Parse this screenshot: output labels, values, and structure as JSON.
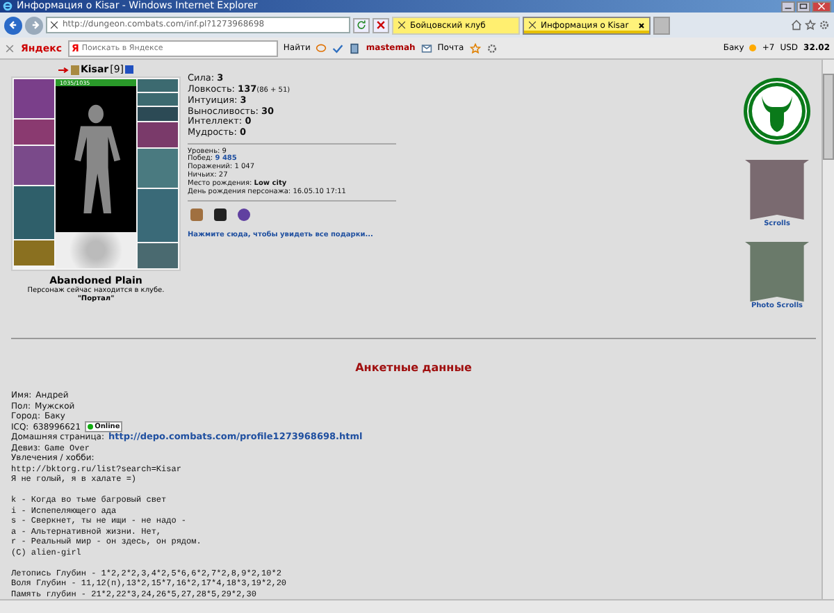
{
  "window": {
    "title": "Информация о Kisar - Windows Internet Explorer"
  },
  "browser": {
    "address": "http://dungeon.combats.com/inf.pl?1273968698",
    "tabs": [
      {
        "label": "Бойцовский клуб",
        "selected": false
      },
      {
        "label": "Информация о Kisar",
        "selected": true
      }
    ]
  },
  "toolbar": {
    "brand": "Яндекс",
    "search_logo": "Я",
    "search_placeholder": "Поискать в Яндексе",
    "find": "Найти",
    "user": "mastemah",
    "mail": "Почта",
    "city": "Баку",
    "temperature": "+7",
    "currency": "USD",
    "rate": "32.02"
  },
  "character": {
    "name": "Kisar",
    "level": "[9]",
    "hp": {
      "text": "1035/1035",
      "level": 1
    },
    "location": "Abandoned Plain",
    "note": "Персонаж сейчас находится в клубе.",
    "club": "\"Портал\""
  },
  "stats": [
    {
      "label": "Сила:",
      "value": "3"
    },
    {
      "label": "Ловкость:",
      "value": "137",
      "extra": "(86 + 51)"
    },
    {
      "label": "Интуиция:",
      "value": "3"
    },
    {
      "label": "Выносливость:",
      "value": "30"
    },
    {
      "label": "Интеллект:",
      "value": "0"
    },
    {
      "label": "Мудрость:",
      "value": "0"
    }
  ],
  "records": [
    {
      "label": "Уровень:",
      "value": "9",
      "kind": "plain"
    },
    {
      "label": "Побед:",
      "value": "9 485",
      "kind": "link"
    },
    {
      "label": "Поражений:",
      "value": "1 047",
      "kind": "plain"
    },
    {
      "label": "Ничьих:",
      "value": "27",
      "kind": "plain"
    },
    {
      "label": "Место рождения:",
      "value": "Low city",
      "kind": "bold"
    },
    {
      "label": "День рождения персонажа:",
      "value": "16.05.10 17:11",
      "kind": "plain"
    }
  ],
  "gifts_link": "Нажмите сюда, чтобы увидеть все подарки...",
  "side": {
    "scrolls": "Scrolls",
    "photo_scrolls": "Photo Scrolls"
  },
  "profile": {
    "heading": "Анкетные данные",
    "fields": [
      {
        "label": "Имя:",
        "value": "Андрей",
        "kind": "plain"
      },
      {
        "label": "Пол:",
        "value": "Мужской",
        "kind": "plain"
      },
      {
        "label": "Город:",
        "value": "Баку",
        "kind": "plain"
      },
      {
        "label": "ICQ:",
        "value": "638996621",
        "kind": "icq",
        "status": "Online",
        "online": true
      },
      {
        "label": "Домашняя страница:",
        "value": "http://depo.combats.com/profile1273968698.html",
        "kind": "link"
      },
      {
        "label": "Девиз:",
        "value": "Game Over",
        "kind": "mono"
      },
      {
        "label": "Увлечения / хобби:",
        "kind": "plain"
      }
    ],
    "paragraphs": [
      [
        "http://bktorg.ru/list?search=Kisar",
        "Я не голый, я в халате =)"
      ],
      [
        "k - Когда во тьме багровый свет",
        "i - Испепеляющего ада",
        "s - Сверкнет, ты не ищи - не надо -",
        "a - Альтернативной жизни. Нет,",
        "r - Реальный мир - он здесь, он рядом.",
        "(C) alien-girl"
      ],
      [
        "Летопись Глубин - 1*2,2*2,3,4*2,5*6,6*2,7*2,8,9*2,10*2",
        "Воля Глубин - 11,12(п),13*2,15*7,16*2,17*4,18*3,19*2,20",
        "Память глубин - 21*2,22*3,24,26*5,27,28*5,29*2,30"
      ]
    ]
  }
}
